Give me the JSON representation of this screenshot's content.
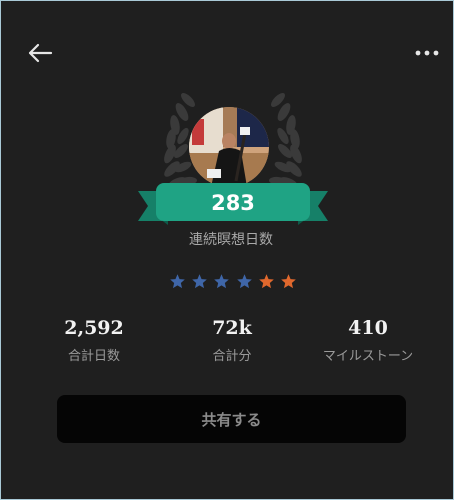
{
  "header": {
    "back_icon": "arrow-left-icon",
    "more_icon": "more-horizontal-icon"
  },
  "badge": {
    "streak_count": "283",
    "streak_label": "連続瞑想日数",
    "ribbon_color": "#1fa384",
    "laurel_color": "#3a3a3a"
  },
  "rating": {
    "stars": [
      {
        "color": "#3f66a8"
      },
      {
        "color": "#3f66a8"
      },
      {
        "color": "#3f66a8"
      },
      {
        "color": "#3f66a8"
      },
      {
        "color": "#e0682d"
      },
      {
        "color": "#e0682d"
      }
    ]
  },
  "stats": [
    {
      "value": "2,592",
      "label": "合計日数"
    },
    {
      "value": "72k",
      "label": "合計分"
    },
    {
      "value": "410",
      "label": "マイルストーン"
    }
  ],
  "share": {
    "label": "共有する"
  },
  "colors": {
    "background": "#1f1f1f",
    "button_bg": "#050505"
  }
}
